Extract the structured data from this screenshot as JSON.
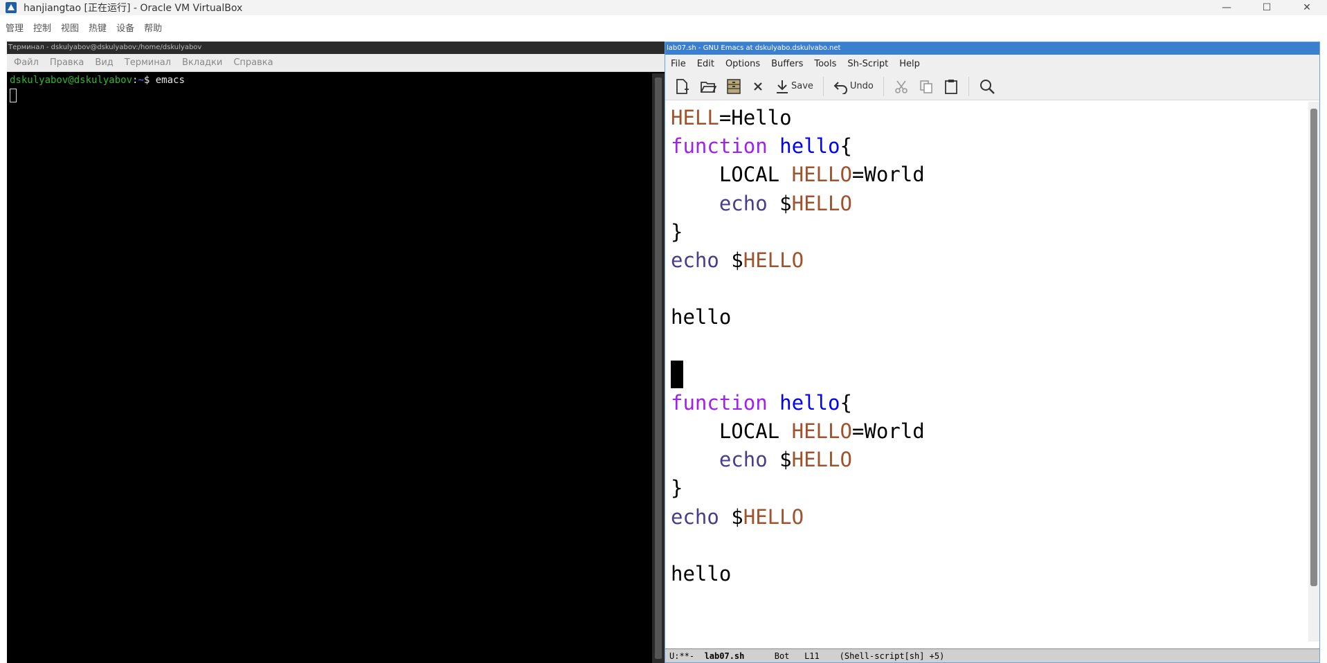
{
  "host": {
    "title": "hanjiangtao [正在运行] - Oracle VM VirtualBox",
    "menu": [
      "管理",
      "控制",
      "视图",
      "热键",
      "设备",
      "帮助"
    ],
    "buttons": {
      "minimize": "—",
      "maximize": "☐",
      "close": "✕"
    }
  },
  "terminal": {
    "title": "Терминал - dskulyabov@dskulyabov:/home/dskulyabov",
    "menu": [
      "Файл",
      "Правка",
      "Вид",
      "Терминал",
      "Вкладки",
      "Справка"
    ],
    "prompt_user": "dskulyabov@dskulyabov",
    "prompt_sep": ":",
    "prompt_path": "~",
    "prompt_end": "$ ",
    "command": "emacs"
  },
  "emacs": {
    "title": "lab07.sh - GNU Emacs at dskulyabo.dskulvabo.net",
    "menu": [
      "File",
      "Edit",
      "Options",
      "Buffers",
      "Tools",
      "Sh-Script",
      "Help"
    ],
    "toolbar": {
      "save_label": "Save",
      "undo_label": "Undo"
    },
    "code": {
      "l1_var": "HELL",
      "l1_rest": "=Hello",
      "kw_function": "function",
      "fn_name": "hello",
      "brace_open": "{",
      "local_kw": "    LOCAL ",
      "hello_var": "HELLO",
      "eq_world": "=World",
      "indent": "    ",
      "echo": "echo",
      "dollar": " $",
      "brace_close": "}",
      "hello_call": "hello"
    },
    "modeline": {
      "state": "U:**-  ",
      "buffer": "lab07.sh",
      "pos": "      Bot   L11    (Shell-script[sh] +5)"
    }
  }
}
